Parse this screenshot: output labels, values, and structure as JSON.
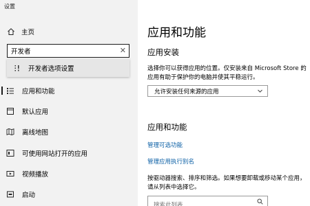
{
  "window": {
    "title": "设置"
  },
  "sidebar": {
    "home_label": "主页",
    "search": {
      "value": "开发者"
    },
    "suggestion": "开发者选项设置",
    "items": [
      {
        "label": "应用和功能",
        "icon": "apps-list-icon",
        "active": true
      },
      {
        "label": "默认应用",
        "icon": "default-apps-icon",
        "active": false
      },
      {
        "label": "离线地图",
        "icon": "offline-maps-icon",
        "active": false
      },
      {
        "label": "可使用网站打开的应用",
        "icon": "apps-for-websites-icon",
        "active": false
      },
      {
        "label": "视频播放",
        "icon": "video-playback-icon",
        "active": false
      },
      {
        "label": "启动",
        "icon": "startup-icon",
        "active": false
      }
    ]
  },
  "main": {
    "page_title": "应用和功能",
    "install_section": {
      "heading": "应用安装",
      "description": "选择你可以获得应用的位置。仅安装来自 Microsoft Store 的应用有助于保护你的电脑并使其平稳运行。",
      "dropdown_value": "允许安装任何来源的应用"
    },
    "apps_section": {
      "heading": "应用和功能",
      "link_optional": "管理可选功能",
      "link_alias": "管理应用执行别名",
      "description": "按驱动器搜索、排序和筛选。如果想要卸载或移动某个应用，请从列表中选择它。",
      "search_placeholder": "搜索此列表"
    }
  },
  "colors": {
    "link": "#0b5fa5",
    "sidebar_bg": "#f2f2f2",
    "suggestion_bg": "#e6e6e6"
  }
}
